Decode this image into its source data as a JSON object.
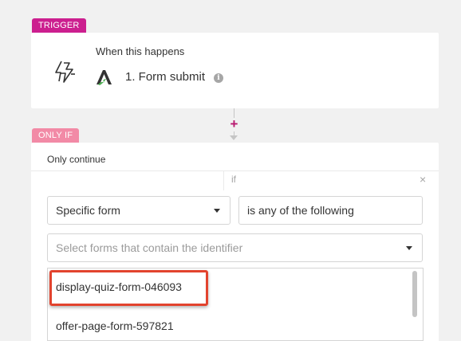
{
  "trigger": {
    "tag": "TRIGGER",
    "when_label": "When this happens",
    "event_label": "1. Form submit",
    "info_glyph": "i",
    "app_icon": "actionetics-logo-icon",
    "trigger_icon": "bolt-icon"
  },
  "connector": {
    "plus": "+"
  },
  "condition": {
    "tag": "ONLY IF",
    "only_continue": "Only continue",
    "if_label": "if",
    "close": "×",
    "field_select": {
      "value": "Specific form"
    },
    "operator_input": {
      "value": "is any of the following"
    },
    "forms_select": {
      "placeholder": "Select forms that contain the identifier"
    },
    "options": [
      "display-quiz-form-046093",
      "offer-page-form-597821"
    ]
  },
  "colors": {
    "trigger_tag": "#cc1f8f",
    "onlyif_tag": "#f28aa6",
    "plus": "#b8186f",
    "highlight": "#e2432e"
  }
}
